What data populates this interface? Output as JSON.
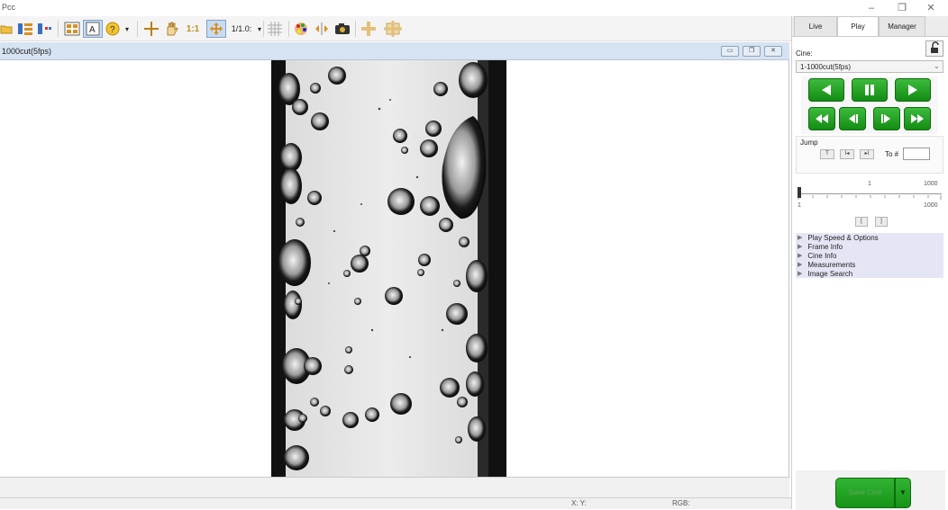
{
  "app": {
    "title": "Pcc"
  },
  "window_controls": {
    "minimize": "–",
    "maximize": "❐",
    "close": "✕"
  },
  "toolbar": {
    "zoom_label": "1/1.0:"
  },
  "child_window": {
    "title": "1000cut(5fps)"
  },
  "status": {
    "xy_label": "X: Y:",
    "rgb_label": "RGB:"
  },
  "panel": {
    "tabs": [
      "Live",
      "Play",
      "Manager"
    ],
    "active_tab": "Play",
    "cine_label": "Cine:",
    "cine_select": "1-1000cut(5fps)",
    "jump_label": "Jump",
    "jump_buttons": [
      "T",
      "I◂",
      "▸I"
    ],
    "to_label": "To #",
    "to_value": "",
    "slider": {
      "start_label": "1",
      "current_label": "1",
      "end_label": "1000",
      "min_label": "1",
      "max_label": "1000",
      "position": 0.0
    },
    "marker_buttons": [
      "[",
      "]"
    ],
    "options": [
      "Play Speed & Options",
      "Frame Info",
      "Cine Info",
      "Measurements",
      "Image Search"
    ],
    "save_label": "Save Cine"
  },
  "colors": {
    "play_green": "#1ea21e",
    "options_bg": "#e5e6f5",
    "child_title_bg": "#d6e3f2"
  }
}
